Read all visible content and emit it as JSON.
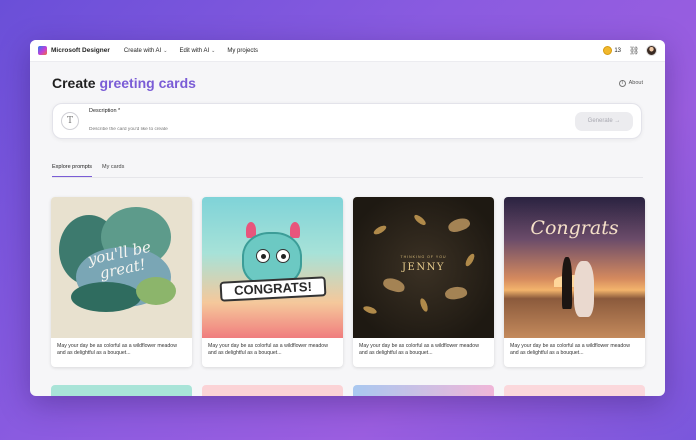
{
  "app": {
    "brand": "Microsoft Designer",
    "nav": [
      {
        "label": "Create with AI"
      },
      {
        "label": "Edit with AI"
      },
      {
        "label": "My projects"
      }
    ],
    "coins": "13"
  },
  "header": {
    "title_prefix": "Create ",
    "title_accent": "greeting cards",
    "about": "About"
  },
  "description": {
    "label": "Description *",
    "placeholder": "Describe the card you'd like to create",
    "generate_label": "Generate →"
  },
  "tabs": [
    {
      "label": "Explore prompts",
      "active": true
    },
    {
      "label": "My cards",
      "active": false
    }
  ],
  "cards": [
    {
      "art_text": "you'll be great!",
      "caption": "May your day be as colorful as a wildflower meadow and as delightful as a bouquet..."
    },
    {
      "art_text": "CONGRATS!",
      "caption": "May your day be as colorful as a wildflower meadow and as delightful as a bouquet..."
    },
    {
      "art_small": "THINKING OF YOU",
      "art_text": "JENNY",
      "caption": "May your day be as colorful as a wildflower meadow and as delightful as a bouquet..."
    },
    {
      "art_text": "Congrats",
      "caption": "May your day be as colorful as a wildflower meadow and as delightful as a bouquet..."
    }
  ],
  "colors": {
    "accent": "#7a5cd6",
    "background_gradient_start": "#6a4fd8",
    "background_gradient_end": "#9b5ee0"
  },
  "icons": [
    "designer-logo-icon",
    "chevron-down-icon",
    "coin-icon",
    "share-icon",
    "avatar",
    "info-icon",
    "text-icon",
    "arrow-right-icon"
  ]
}
